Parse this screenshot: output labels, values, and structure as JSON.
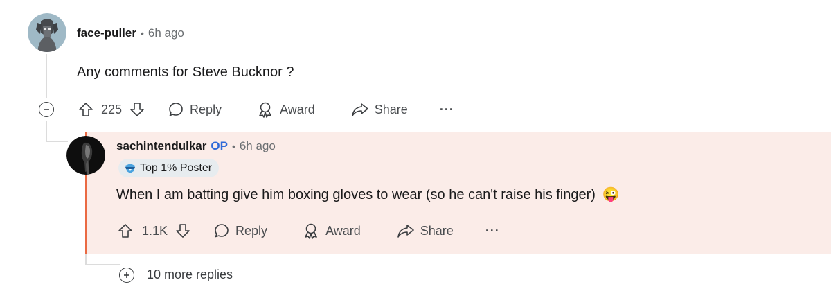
{
  "comment": {
    "username": "face-puller",
    "time": "6h ago",
    "text": "Any comments for Steve Bucknor ?",
    "upvotes": "225",
    "reply_label": "Reply",
    "award_label": "Award",
    "share_label": "Share",
    "more_label": "···"
  },
  "reply": {
    "username": "sachintendulkar",
    "op_label": "OP",
    "time": "6h ago",
    "flair": "Top 1% Poster",
    "text": "When I am batting give him boxing gloves to wear (so he can't raise his finger)",
    "emoji": "😜",
    "upvotes": "1.1K",
    "reply_label": "Reply",
    "award_label": "Award",
    "share_label": "Share",
    "more_label": "···"
  },
  "more_replies": "10 more replies",
  "colors": {
    "accent": "#ea6a43",
    "op": "#2f6ad8",
    "highlight_bg": "#fbece8"
  }
}
